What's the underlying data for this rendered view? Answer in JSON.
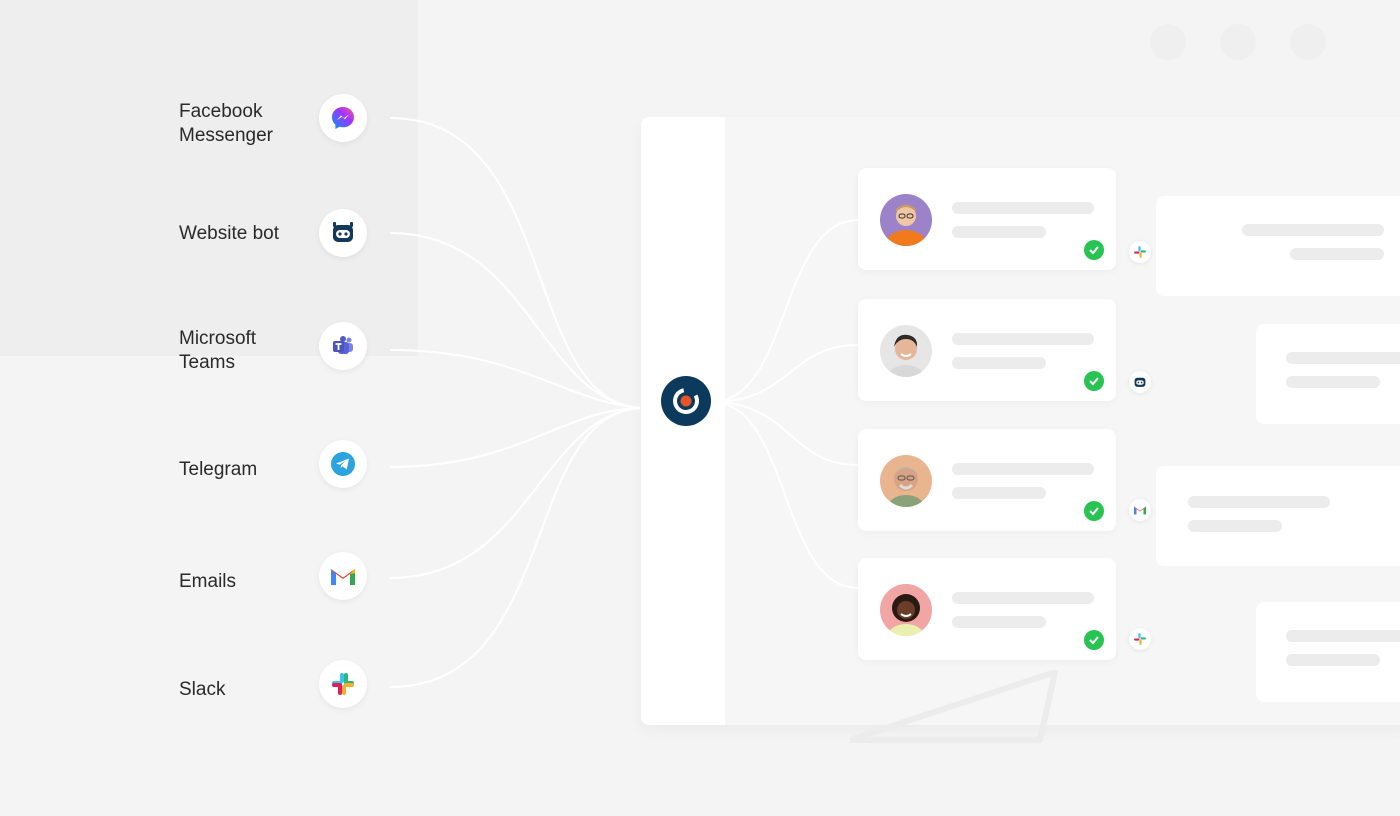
{
  "channels": [
    {
      "label_line1": "Facebook",
      "label_line2": "Messenger",
      "icon": "messenger-icon"
    },
    {
      "label_line1": "Website bot",
      "label_line2": "",
      "icon": "robot-icon"
    },
    {
      "label_line1": "Microsoft",
      "label_line2": "Teams",
      "icon": "teams-icon"
    },
    {
      "label_line1": "Telegram",
      "label_line2": "",
      "icon": "telegram-icon"
    },
    {
      "label_line1": "Emails",
      "label_line2": "",
      "icon": "gmail-icon"
    },
    {
      "label_line1": "Slack",
      "label_line2": "",
      "icon": "slack-icon"
    }
  ],
  "hub": {
    "icon": "hub-logo-icon"
  },
  "agents": [
    {
      "avatar": "avatar-man-glasses",
      "status": "check-icon",
      "channel_icon": "slack-icon"
    },
    {
      "avatar": "avatar-woman-smiling",
      "status": "check-icon",
      "channel_icon": "robot-icon"
    },
    {
      "avatar": "avatar-older-man",
      "status": "check-icon",
      "channel_icon": "gmail-icon"
    },
    {
      "avatar": "avatar-woman-curly-hair",
      "status": "check-icon",
      "channel_icon": "slack-icon"
    }
  ],
  "colors": {
    "accent": "#0c3a5c",
    "check": "#27c452",
    "hub_dot": "#e8532b"
  }
}
